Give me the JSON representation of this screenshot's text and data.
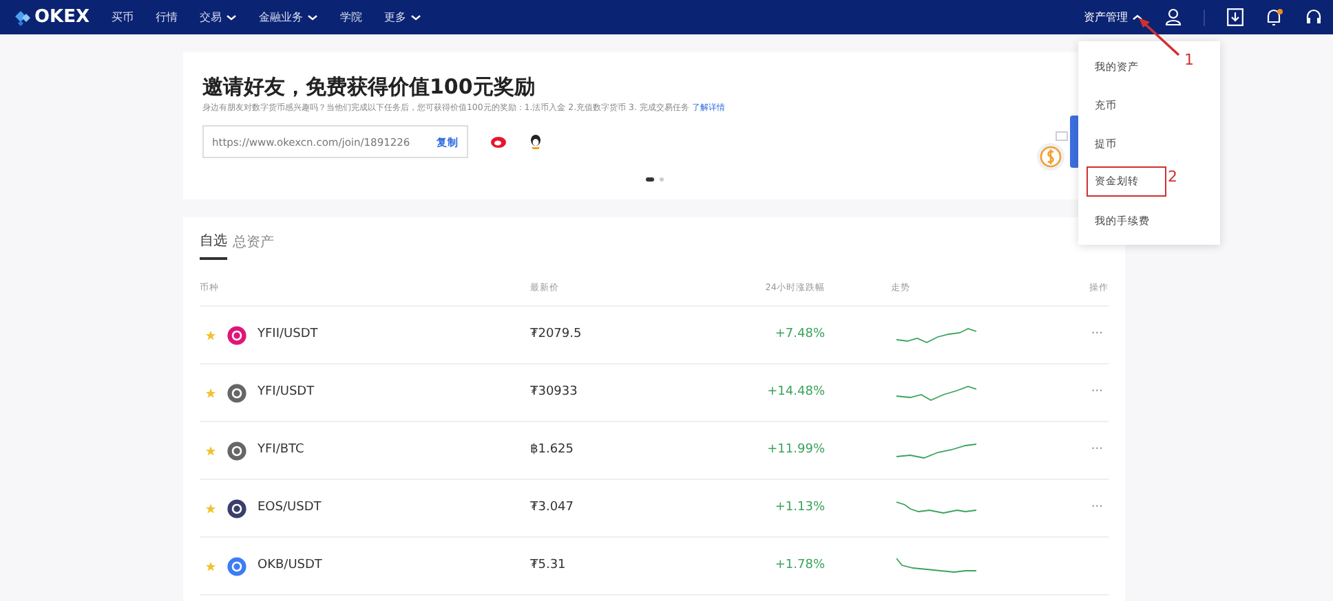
{
  "navbar": {
    "logo": "OKEX",
    "items": [
      {
        "label": "买币",
        "dropdown": false
      },
      {
        "label": "行情",
        "dropdown": false
      },
      {
        "label": "交易",
        "dropdown": true
      },
      {
        "label": "金融业务",
        "dropdown": true
      },
      {
        "label": "学院",
        "dropdown": false
      },
      {
        "label": "更多",
        "dropdown": true
      }
    ],
    "asset_menu": {
      "label": "资产管理",
      "expanded": true
    },
    "notification_dot": true
  },
  "invite": {
    "title": "邀请好友，免费获得价值100元奖励",
    "description": "身边有朋友对数字货币感兴趣吗？当他们完成以下任务后，您可获得价值100元的奖励：1.法币入金 2.充值数字货币 3. 完成交易任务",
    "learn_more": "了解详情",
    "link_value": "https://www.okexcn.com/join/1891226",
    "copy_button": "复制",
    "carousel": [
      {
        "selected": true
      },
      {
        "selected": false
      }
    ]
  },
  "dropdown": [
    {
      "label": "我的资产",
      "highlighted": false
    },
    {
      "label": "充币",
      "highlighted": false
    },
    {
      "label": "提币",
      "highlighted": false
    },
    {
      "label": "资金划转",
      "highlighted": true
    },
    {
      "label": "我的手续费",
      "highlighted": false
    }
  ],
  "annotations": [
    {
      "label": "1"
    },
    {
      "label": "2"
    }
  ],
  "market": {
    "tabs": [
      {
        "label": "自选",
        "selected": true
      },
      {
        "label": "总资产",
        "selected": false
      }
    ],
    "columns": [
      "币种",
      "最新价",
      "24小时涨跌幅",
      "走势",
      "操作"
    ],
    "rows": [
      {
        "pair": "YFII/USDT",
        "price": "₮2079.5",
        "change": "+7.48%",
        "starred": true,
        "color": "#e0157a",
        "more": "···"
      },
      {
        "pair": "YFI/USDT",
        "price": "₮30933",
        "change": "+14.48%",
        "starred": true,
        "color": "#666666",
        "more": "···"
      },
      {
        "pair": "YFI/BTC",
        "price": "฿1.625",
        "change": "+11.99%",
        "starred": true,
        "color": "#666666",
        "more": "···"
      },
      {
        "pair": "EOS/USDT",
        "price": "₮3.047",
        "change": "+1.13%",
        "starred": true,
        "color": "#3a3f6b",
        "more": "···"
      },
      {
        "pair": "OKB/USDT",
        "price": "₮5.31",
        "change": "+1.78%",
        "starred": true,
        "color": "#3d7cf5",
        "more": ""
      }
    ]
  }
}
